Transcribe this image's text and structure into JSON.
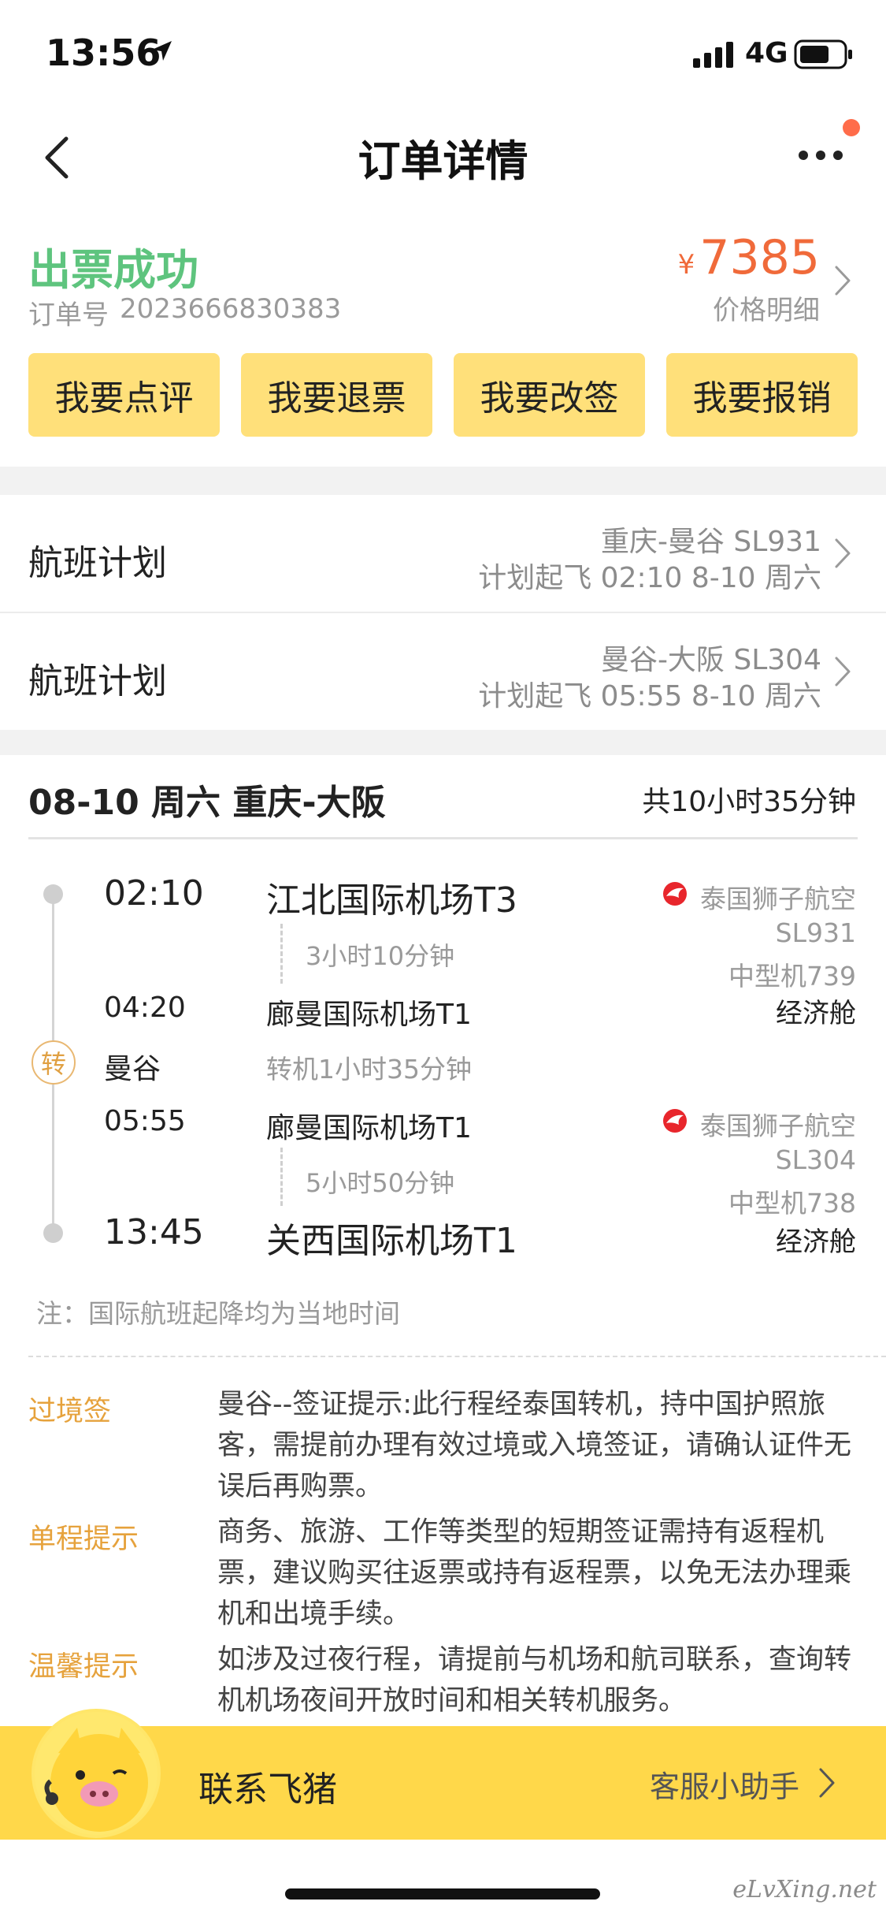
{
  "status_bar": {
    "time": "13:56",
    "network": "4G"
  },
  "nav": {
    "title": "订单详情"
  },
  "order": {
    "status": "出票成功",
    "number_label": "订单号",
    "number": "2023666830383",
    "currency": "¥",
    "price": "7385",
    "price_detail": "价格明细"
  },
  "actions": [
    "我要点评",
    "我要退票",
    "我要改签",
    "我要报销"
  ],
  "flight_plans": [
    {
      "label": "航班计划",
      "route": "重庆-曼谷 SL931",
      "schedule": "计划起飞 02:10 8-10 周六"
    },
    {
      "label": "航班计划",
      "route": "曼谷-大阪 SL304",
      "schedule": "计划起飞 05:55 8-10 周六"
    }
  ],
  "itinerary": {
    "header": "08-10 周六 重庆-大阪",
    "total": "共10小时35分钟",
    "legs": [
      {
        "dep_time": "02:10",
        "dep_airport": "江北国际机场T3",
        "duration": "3小时10分钟",
        "arr_time": "04:20",
        "arr_airport": "廊曼国际机场T1",
        "airline": "泰国狮子航空",
        "flight_no": "SL931",
        "aircraft": "中型机739",
        "cabin": "经济舱"
      },
      {
        "dep_time": "05:55",
        "dep_airport": "廊曼国际机场T1",
        "duration": "5小时50分钟",
        "arr_time": "13:45",
        "arr_airport": "关西国际机场T1",
        "airline": "泰国狮子航空",
        "flight_no": "SL304",
        "aircraft": "中型机738",
        "cabin": "经济舱"
      }
    ],
    "transfer_mark": "转",
    "transfer_city": "曼谷",
    "transfer_time": "转机1小时35分钟",
    "note": "注：国际航班起降均为当地时间"
  },
  "tips": [
    {
      "label": "过境签",
      "text": "曼谷--签证提示:此行程经泰国转机，持中国护照旅客，需提前办理有效过境或入境签证，请确认证件无误后再购票。"
    },
    {
      "label": "单程提示",
      "text": "商务、旅游、工作等类型的短期签证需持有返程机票，建议购买往返票或持有返程票，以免无法办理乘机和出境手续。"
    },
    {
      "label": "温馨提示",
      "text": "如涉及过夜行程，请提前与机场和航司联系，查询转机机场夜间开放时间和相关转机服务。"
    }
  ],
  "contact": {
    "label": "联系飞猪",
    "assistant": "客服小助手"
  },
  "watermark": "eLvXing.net",
  "colors": {
    "success": "#5ec47e",
    "price": "#f06a3a",
    "button": "#ffe07a",
    "contact_bar": "#ffd84a",
    "tip_label": "#e6a23c"
  },
  "icons": [
    "location-arrow-icon",
    "signal-icon",
    "battery-icon",
    "back-icon",
    "more-icon",
    "chevron-right-icon",
    "airline-logo-icon",
    "mascot-icon"
  ]
}
